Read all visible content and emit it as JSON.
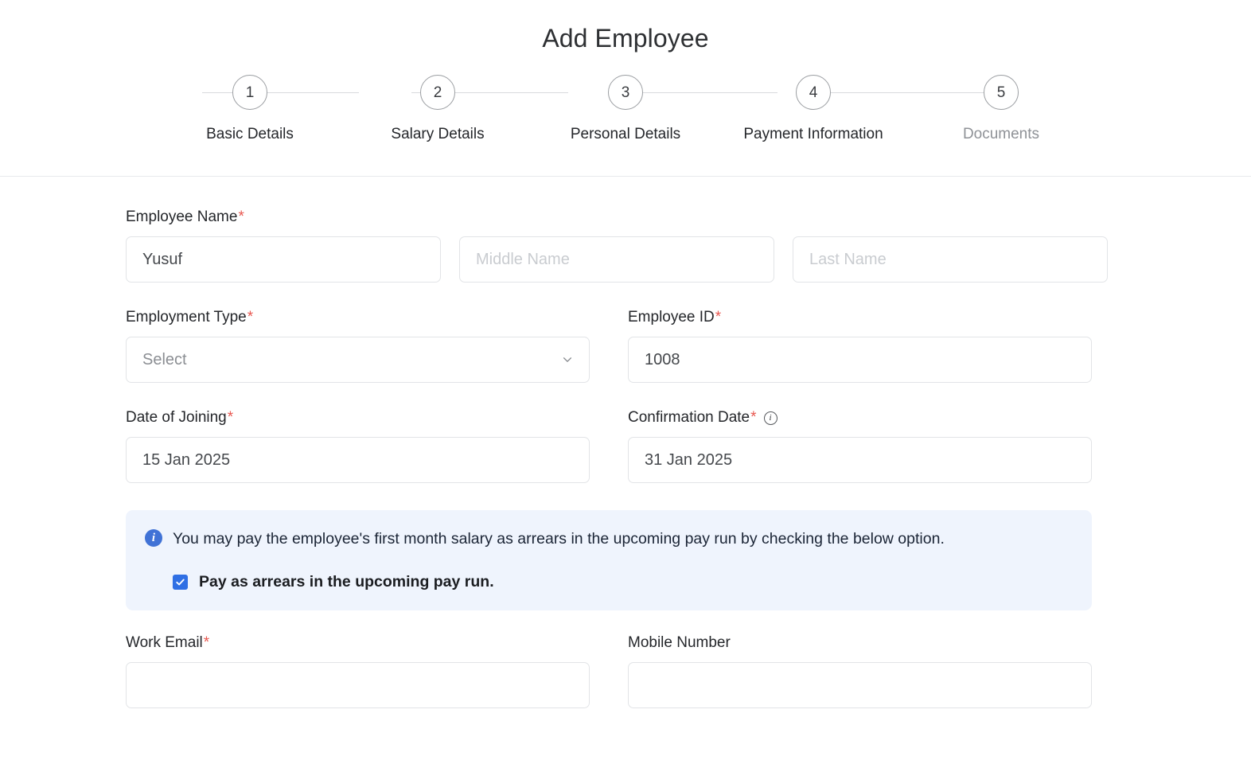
{
  "header": {
    "title": "Add Employee"
  },
  "stepper": {
    "steps": [
      {
        "number": "1",
        "label": "Basic Details",
        "state": "active"
      },
      {
        "number": "2",
        "label": "Salary Details",
        "state": "active"
      },
      {
        "number": "3",
        "label": "Personal Details",
        "state": "active"
      },
      {
        "number": "4",
        "label": "Payment Information",
        "state": "active"
      },
      {
        "number": "5",
        "label": "Documents",
        "state": "muted"
      }
    ]
  },
  "form": {
    "employee_name": {
      "label": "Employee Name",
      "required_mark": "*",
      "first_value": "Yusuf",
      "middle_placeholder": "Middle Name",
      "last_placeholder": "Last Name"
    },
    "employment_type": {
      "label": "Employment Type",
      "required_mark": "*",
      "value": "Select",
      "icon": "chevron-down-icon"
    },
    "employee_id": {
      "label": "Employee ID",
      "required_mark": "*",
      "value": "1008"
    },
    "date_of_joining": {
      "label": "Date of Joining",
      "required_mark": "*",
      "value": "15 Jan 2025"
    },
    "confirmation_date": {
      "label": "Confirmation Date",
      "required_mark": "*",
      "info_icon": "info-icon",
      "info_glyph": "i",
      "value": "31 Jan 2025"
    },
    "work_email": {
      "label": "Work Email",
      "required_mark": "*",
      "value": ""
    },
    "mobile_number": {
      "label": "Mobile Number",
      "required_mark": "",
      "value": ""
    }
  },
  "notice": {
    "icon": "info-icon",
    "icon_glyph": "i",
    "text": "You may pay the employee's first month salary as arrears in the upcoming pay run by checking the below option.",
    "checkbox_label": "Pay as arrears in the upcoming pay run.",
    "checkbox_checked": true
  },
  "colors": {
    "accent_blue": "#2f6fe4",
    "notice_bg": "#eff4fd",
    "required_red": "#e8574f",
    "border_gray": "#e2e4e7",
    "muted_text": "#8f9297"
  }
}
